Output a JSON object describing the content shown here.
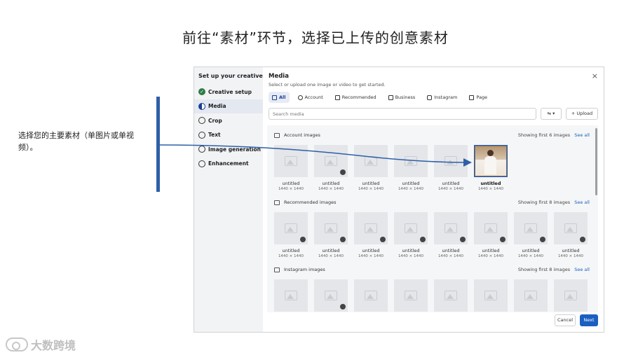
{
  "slide": {
    "title": "前往“素材”环节，选择已上传的创意素材",
    "callout": "选择您的主要素材（单图片或单视频）。",
    "watermark": "大数跨境"
  },
  "sidebar": {
    "title": "Set up your creative",
    "items": [
      {
        "label": "Creative setup",
        "state": "complete"
      },
      {
        "label": "Media",
        "state": "active"
      },
      {
        "label": "Crop",
        "state": "todo"
      },
      {
        "label": "Text",
        "state": "todo"
      },
      {
        "label": "Image generation",
        "state": "todo"
      },
      {
        "label": "Enhancement",
        "state": "todo"
      }
    ]
  },
  "main": {
    "title": "Media",
    "subtitle": "Select or upload one image or video to get started.",
    "close": "×",
    "tabs": [
      {
        "label": "All",
        "icon": "grid-icon"
      },
      {
        "label": "Account",
        "icon": "user-icon"
      },
      {
        "label": "Recommended",
        "icon": "shield-icon"
      },
      {
        "label": "Business",
        "icon": "briefcase-icon"
      },
      {
        "label": "Instagram",
        "icon": "instagram-icon"
      },
      {
        "label": "Page",
        "icon": "page-icon"
      }
    ],
    "search": {
      "placeholder": "Search media"
    },
    "filter_label": "⇆ ▾",
    "upload_label": "+ Upload",
    "see_all": "See all",
    "sections": [
      {
        "title": "Account images",
        "showing": "Showing first 6 images",
        "items": [
          {
            "name": "untitled",
            "size": "1440 × 1440",
            "badge": false,
            "selected": false
          },
          {
            "name": "untitled",
            "size": "1440 × 1440",
            "badge": true,
            "selected": false
          },
          {
            "name": "untitled",
            "size": "1440 × 1440",
            "badge": false,
            "selected": false
          },
          {
            "name": "untitled",
            "size": "1440 × 1440",
            "badge": false,
            "selected": false
          },
          {
            "name": "untitled",
            "size": "1440 × 1440",
            "badge": false,
            "selected": false
          },
          {
            "name": "untitled",
            "size": "1440 × 1440",
            "badge": false,
            "selected": true
          }
        ]
      },
      {
        "title": "Recommended images",
        "showing": "Showing first 8 images",
        "items": [
          {
            "name": "untitled",
            "size": "1440 × 1440",
            "badge": true
          },
          {
            "name": "untitled",
            "size": "1440 × 1440",
            "badge": true
          },
          {
            "name": "untitled",
            "size": "1440 × 1440",
            "badge": true
          },
          {
            "name": "untitled",
            "size": "1440 × 1440",
            "badge": true
          },
          {
            "name": "untitled",
            "size": "1440 × 1440",
            "badge": true
          },
          {
            "name": "untitled",
            "size": "1440 × 1440",
            "badge": true
          },
          {
            "name": "untitled",
            "size": "1440 × 1440",
            "badge": true
          },
          {
            "name": "untitled",
            "size": "1440 × 1440",
            "badge": true
          }
        ]
      },
      {
        "title": "Instagram images",
        "showing": "Showing first 8 images",
        "items": [
          {
            "badge": false
          },
          {
            "badge": true
          },
          {
            "badge": false
          },
          {
            "badge": false
          },
          {
            "badge": false
          },
          {
            "badge": false
          },
          {
            "badge": false
          },
          {
            "badge": false
          }
        ]
      }
    ],
    "cancel_label": "Cancel",
    "next_label": "Next"
  },
  "colors": {
    "accent": "#1b5fc1",
    "complete": "#2d7d46",
    "callout_bar": "#2f5fa8"
  }
}
